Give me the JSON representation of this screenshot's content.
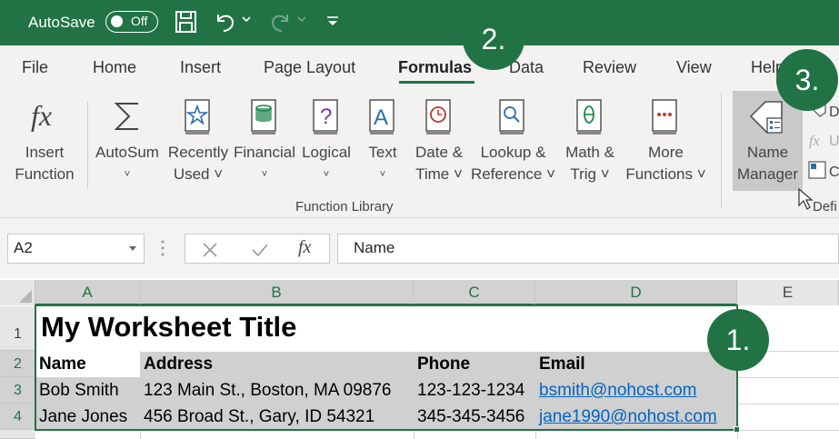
{
  "titlebar": {
    "autosave_label": "AutoSave",
    "toggle_state": "Off",
    "icons": [
      "save-icon",
      "undo-icon",
      "redo-icon",
      "customize-icon"
    ]
  },
  "tabs": [
    {
      "label": "File"
    },
    {
      "label": "Home"
    },
    {
      "label": "Insert"
    },
    {
      "label": "Page Layout"
    },
    {
      "label": "Formulas",
      "active": true
    },
    {
      "label": "Data"
    },
    {
      "label": "Review"
    },
    {
      "label": "View"
    },
    {
      "label": "Help"
    }
  ],
  "ribbon": {
    "insert_function": {
      "line1": "Insert",
      "line2": "Function"
    },
    "autosum": {
      "line1": "AutoSum",
      "line2": "˅"
    },
    "recently_used": {
      "line1": "Recently",
      "line2": "Used ˅"
    },
    "financial": {
      "line1": "Financial",
      "line2": "˅"
    },
    "logical": {
      "line1": "Logical",
      "line2": "˅"
    },
    "text": {
      "line1": "Text",
      "line2": "˅"
    },
    "date_time": {
      "line1": "Date &",
      "line2": "Time ˅"
    },
    "lookup": {
      "line1": "Lookup &",
      "line2": "Reference ˅"
    },
    "math": {
      "line1": "Math &",
      "line2": "Trig ˅"
    },
    "more": {
      "line1": "More",
      "line2": "Functions ˅"
    },
    "name_manager": {
      "line1": "Name",
      "line2": "Manager"
    },
    "group_label": "Function Library",
    "defined_names_partial": "Defi",
    "colors": {
      "accent": "#217346",
      "icon_blue": "#2b6cb0",
      "icon_red": "#c0392b",
      "icon_purple": "#7d3c98",
      "icon_green": "#1e8449"
    }
  },
  "formula_bar": {
    "namebox_value": "A2",
    "fx_symbol": "fx",
    "value": "Name"
  },
  "grid": {
    "columns": [
      "A",
      "B",
      "C",
      "D",
      "E"
    ],
    "rows": [
      "1",
      "2",
      "3",
      "4"
    ],
    "title": "My Worksheet Title",
    "headers": [
      "Name",
      "Address",
      "Phone",
      "Email"
    ],
    "data": [
      [
        "Bob Smith",
        "123 Main St., Boston, MA 09876",
        "123-123-1234",
        "bsmith@nohost.com"
      ],
      [
        "Jane Jones",
        "456 Broad St., Gary, ID 54321",
        "345-345-3456",
        "jane1990@nohost.com"
      ]
    ]
  },
  "callouts": [
    "1.",
    "2.",
    "3."
  ]
}
